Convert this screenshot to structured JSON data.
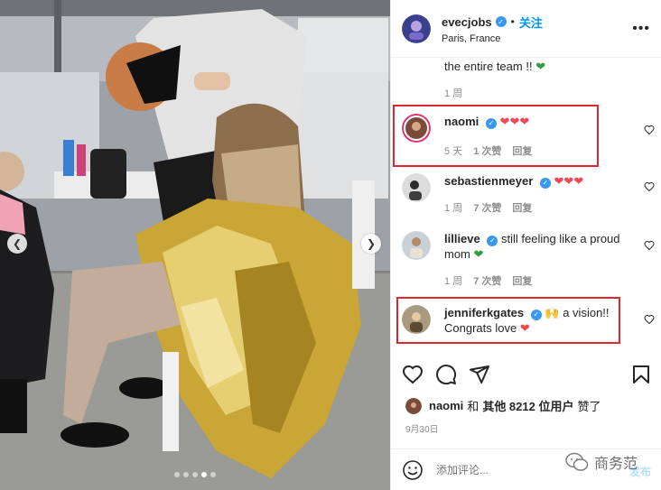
{
  "post": {
    "image_alt": "Backstage makeup artist working on model wrapped in gold foil",
    "carousel_total": 5,
    "carousel_active": 4
  },
  "header": {
    "username": "evecjobs",
    "follow_label": "关注",
    "location": "Paris, France",
    "more_icon": "more-icon",
    "bullet": "•"
  },
  "comments": {
    "top_text": "the entire team !!",
    "top_time": "1 周",
    "items": [
      {
        "username": "naomi",
        "time": "5 天",
        "likes": "1 次赞",
        "reply": "回复"
      },
      {
        "username": "sebastienmeyer",
        "time": "1 周",
        "likes": "7 次赞",
        "reply": "回复"
      },
      {
        "username": "lillieve",
        "text": "still feeling like a proud mom",
        "time": "1 周",
        "likes": "7 次赞",
        "reply": "回复"
      },
      {
        "username": "jenniferkgates",
        "text": "a vision!! Congrats love"
      }
    ]
  },
  "likes": {
    "user": "naomi",
    "connector": "和",
    "others": "其他 8212 位用户",
    "suffix": "赞了"
  },
  "date": "9月30日",
  "add_comment": {
    "placeholder": "添加评论...",
    "post_label": "发布"
  },
  "watermark": "商务范",
  "colors": {
    "accent": "#0095f6",
    "heart_red": "#ed4956",
    "heart_green": "#2ea043",
    "highlight_box": "#e0262f",
    "verified": "#3897f0"
  }
}
